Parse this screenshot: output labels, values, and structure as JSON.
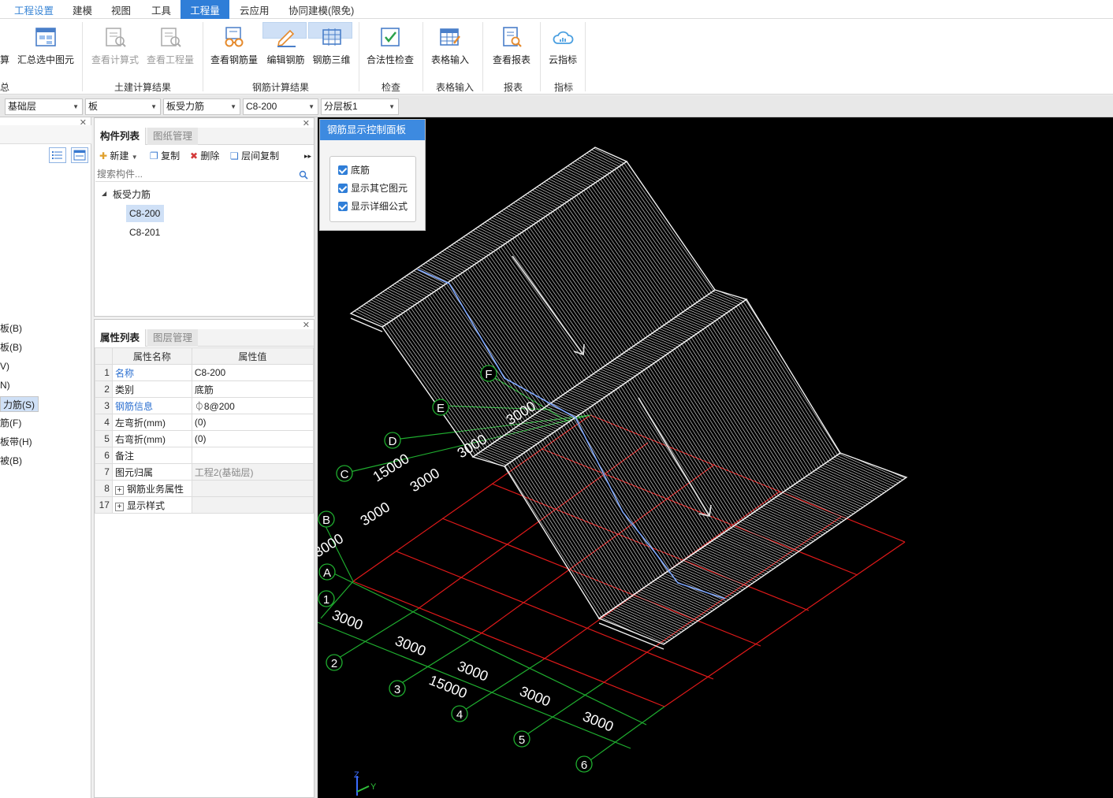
{
  "menu": {
    "items": [
      "工程设置",
      "建模",
      "视图",
      "工具",
      "工程量",
      "云应用",
      "协同建模(限免)"
    ]
  },
  "ribbon": {
    "buttons": {
      "calc_partial": "算",
      "summary_selected": "汇总选中图元",
      "view_formula": "查看计算式",
      "view_quantity": "查看工程量",
      "view_rebar_qty": "查看钢筋量",
      "edit_rebar": "编辑钢筋",
      "rebar_3d": "钢筋三维",
      "legality_check": "合法性检查",
      "table_input": "表格输入",
      "view_report": "查看报表",
      "cloud_index": "云指标"
    },
    "groups": {
      "summary": "汇总",
      "civil_result": "土建计算结果",
      "rebar_result": "钢筋计算结果",
      "check": "检查",
      "table_input": "表格输入",
      "report": "报表",
      "index": "指标"
    }
  },
  "selectors": {
    "floor": "基础层",
    "category": "板",
    "type": "板受力筋",
    "component": "C8-200",
    "layer": "分层板1"
  },
  "left_strip": {
    "items": [
      "板(B)",
      "板(B)",
      "V)",
      "N)",
      "力筋(S)",
      "筋(F)",
      "板带(H)",
      "被(B)"
    ]
  },
  "component_panel": {
    "tabs": [
      "构件列表",
      "图纸管理"
    ],
    "toolbar": {
      "new": "新建",
      "copy": "复制",
      "delete": "删除",
      "floor_copy": "层间复制"
    },
    "search_placeholder": "搜索构件...",
    "tree_root": "板受力筋",
    "tree_items": [
      "C8-200",
      "C8-201"
    ]
  },
  "property_panel": {
    "tabs": [
      "属性列表",
      "图层管理"
    ],
    "headers": [
      "属性名称",
      "属性值"
    ],
    "rows": [
      {
        "num": "1",
        "name": "名称",
        "value": "C8-200"
      },
      {
        "num": "2",
        "name": "类别",
        "value": "底筋"
      },
      {
        "num": "3",
        "name": "钢筋信息",
        "value": "⏀8@200"
      },
      {
        "num": "4",
        "name": "左弯折(mm)",
        "value": "(0)"
      },
      {
        "num": "5",
        "name": "右弯折(mm)",
        "value": "(0)"
      },
      {
        "num": "6",
        "name": "备注",
        "value": ""
      },
      {
        "num": "7",
        "name": "图元归属",
        "value": "工程2(基础层)"
      },
      {
        "num": "8",
        "name": "钢筋业务属性",
        "value": ""
      },
      {
        "num": "17",
        "name": "显示样式",
        "value": ""
      }
    ]
  },
  "control_panel": {
    "title": "钢筋显示控制面板",
    "options": [
      "底筋",
      "显示其它图元",
      "显示详细公式"
    ]
  },
  "viewport": {
    "axis_letters": [
      "D",
      "C",
      "B",
      "A",
      "E",
      "F"
    ],
    "axis_numbers": [
      "1",
      "2",
      "3",
      "4",
      "5",
      "6"
    ],
    "dims": [
      "15000",
      "3000",
      "3000",
      "3000",
      "3000",
      "3000",
      "3000",
      "3000",
      "15000",
      "3000",
      "3000",
      "3000",
      "3000"
    ],
    "colors": {
      "grid_green": "#1fae2f",
      "grid_red": "#e01919",
      "rebar": "#c9c9c9",
      "rebar_blue": "#7fa8ff"
    },
    "axis_labels": {
      "z": "Z",
      "y": "Y"
    }
  }
}
